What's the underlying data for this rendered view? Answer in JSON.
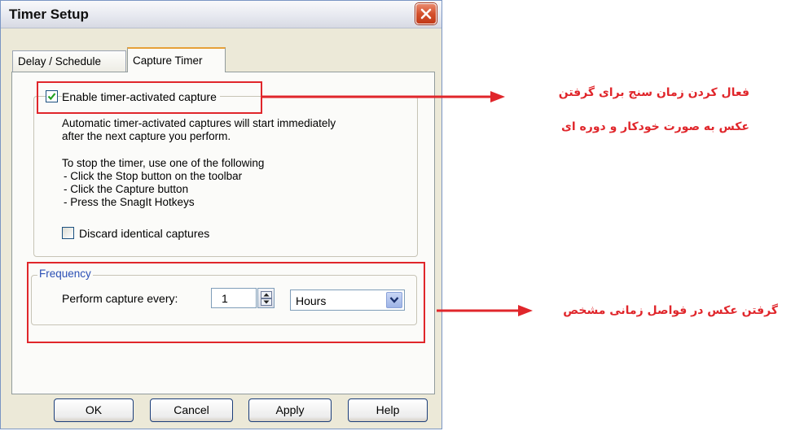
{
  "window": {
    "title": "Timer Setup",
    "close_icon": "close-icon"
  },
  "tabs": [
    {
      "label": "Delay / Schedule",
      "active": false
    },
    {
      "label": "Capture Timer",
      "active": true
    }
  ],
  "capture": {
    "enable_label": "Enable timer-activated capture",
    "enable_checked": true,
    "description_line1": "Automatic timer-activated captures will start immediately",
    "description_line2": "after the next capture you perform.",
    "stop_intro": "To stop the timer, use one of the following",
    "stop_items": [
      "- Click the Stop button on the toolbar",
      "- Click the Capture button",
      "- Press the SnagIt Hotkeys"
    ],
    "discard_label": "Discard identical captures",
    "discard_checked": false
  },
  "frequency": {
    "legend": "Frequency",
    "perform_label": "Perform capture every:",
    "interval_value": "1",
    "unit_value": "Hours"
  },
  "buttons": {
    "ok": "OK",
    "cancel": "Cancel",
    "apply": "Apply",
    "help": "Help"
  },
  "annotations": {
    "enable_note_line1": "فعال کردن زمان سنج برای گرفتن",
    "enable_note_line2": "عکس به صورت خودکار و دوره ای",
    "frequency_note": "گرفتن عکس در فواصل زمانی مشخص",
    "highlight_color": "#e0262b"
  }
}
